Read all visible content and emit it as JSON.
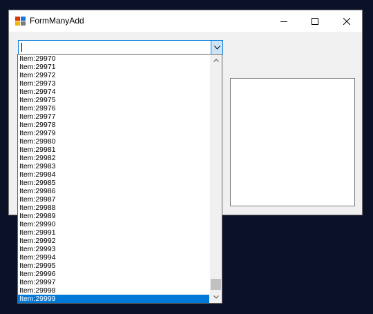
{
  "window": {
    "title": "FormManyAdd",
    "controls": {
      "minimize": "minimize-icon",
      "maximize": "maximize-icon",
      "close": "close-icon"
    }
  },
  "combobox": {
    "value": "",
    "dropdown_icon": "chevron-down-icon",
    "items": [
      "Item:29970",
      "Item:29971",
      "Item:29972",
      "Item:29973",
      "Item:29974",
      "Item:29975",
      "Item:29976",
      "Item:29977",
      "Item:29978",
      "Item:29979",
      "Item:29980",
      "Item:29981",
      "Item:29982",
      "Item:29983",
      "Item:29984",
      "Item:29985",
      "Item:29986",
      "Item:29987",
      "Item:29988",
      "Item:29989",
      "Item:29990",
      "Item:29991",
      "Item:29992",
      "Item:29993",
      "Item:29994",
      "Item:29995",
      "Item:29996",
      "Item:29997",
      "Item:29998",
      "Item:29999"
    ],
    "selected_index": 29
  },
  "textbox": {
    "value": ""
  },
  "colors": {
    "accent": "#0078d7",
    "desktop": "#0b1228",
    "window_bg": "#f0f0f0"
  }
}
